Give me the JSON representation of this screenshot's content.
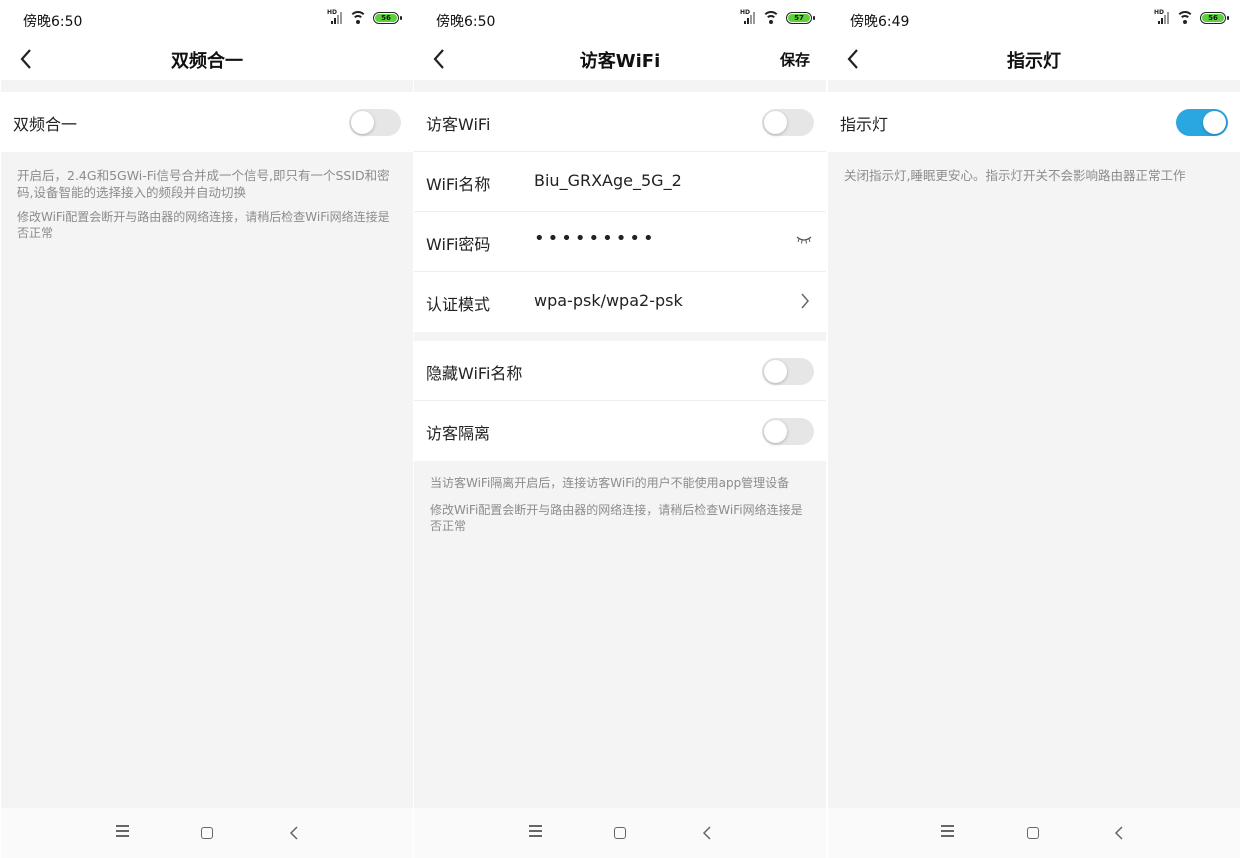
{
  "screens": [
    {
      "status": {
        "time": "傍晚6:50",
        "battery": "56"
      },
      "title": "双频合一",
      "rows": [
        {
          "label": "双频合一",
          "toggle": false
        }
      ],
      "notes": [
        "开启后，2.4G和5GWi-Fi信号合并成一个信号,即只有一个SSID和密码,设备智能的选择接入的频段并自动切换",
        "修改WiFi配置会断开与路由器的网络连接，请稍后检查WiFi网络连接是否正常"
      ]
    },
    {
      "status": {
        "time": "傍晚6:50",
        "battery": "57"
      },
      "title": "访客WiFi",
      "save_label": "保存",
      "rows": [
        {
          "label": "访客WiFi",
          "toggle": false
        },
        {
          "label": "WiFi名称",
          "value": "Biu_GRXAge_5G_2"
        },
        {
          "label": "WiFi密码",
          "value": "•••••••••",
          "icon": "eye-closed-icon"
        },
        {
          "label": "认证模式",
          "value": "wpa-psk/wpa2-psk",
          "icon": "chevron-right-icon"
        }
      ],
      "rows2": [
        {
          "label": "隐藏WiFi名称",
          "toggle": false
        },
        {
          "label": "访客隔离",
          "toggle": false
        }
      ],
      "notes": [
        "当访客WiFi隔离开启后，连接访客WiFi的用户不能使用app管理设备",
        "修改WiFi配置会断开与路由器的网络连接，请稍后检查WiFi网络连接是否正常"
      ]
    },
    {
      "status": {
        "time": "傍晚6:49",
        "battery": "56"
      },
      "title": "指示灯",
      "rows": [
        {
          "label": "指示灯",
          "toggle": true
        }
      ],
      "notes": [
        "关闭指示灯,睡眠更安心。指示灯开关不会影响路由器正常工作"
      ]
    }
  ],
  "colors": {
    "accent": "#2aa7e0",
    "battery": "#5ed13a",
    "note_text": "#8c8c8c"
  }
}
